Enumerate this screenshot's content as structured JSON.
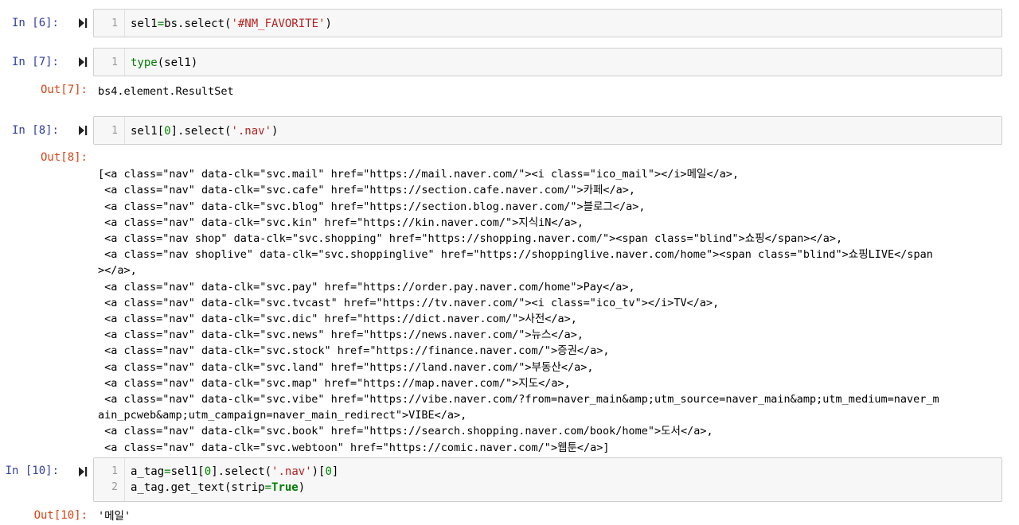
{
  "cells": {
    "c6": {
      "in_prompt": "In [6]:",
      "line": "1"
    },
    "c7": {
      "in_prompt": "In [7]:",
      "line": "1",
      "out_prompt": "Out[7]:",
      "output": "bs4.element.ResultSet"
    },
    "c8": {
      "in_prompt": "In [8]:",
      "line": "1",
      "out_prompt": "Out[8]:",
      "output_lines": [
        "[<a class=\"nav\" data-clk=\"svc.mail\" href=\"https://mail.naver.com/\"><i class=\"ico_mail\"></i>메일</a>,",
        " <a class=\"nav\" data-clk=\"svc.cafe\" href=\"https://section.cafe.naver.com/\">카페</a>,",
        " <a class=\"nav\" data-clk=\"svc.blog\" href=\"https://section.blog.naver.com/\">블로그</a>,",
        " <a class=\"nav\" data-clk=\"svc.kin\" href=\"https://kin.naver.com/\">지식iN</a>,",
        " <a class=\"nav shop\" data-clk=\"svc.shopping\" href=\"https://shopping.naver.com/\"><span class=\"blind\">쇼핑</span></a>,",
        " <a class=\"nav shoplive\" data-clk=\"svc.shoppinglive\" href=\"https://shoppinglive.naver.com/home\"><span class=\"blind\">쇼핑LIVE</span",
        "></a>,",
        " <a class=\"nav\" data-clk=\"svc.pay\" href=\"https://order.pay.naver.com/home\">Pay</a>,",
        " <a class=\"nav\" data-clk=\"svc.tvcast\" href=\"https://tv.naver.com/\"><i class=\"ico_tv\"></i>TV</a>,",
        " <a class=\"nav\" data-clk=\"svc.dic\" href=\"https://dict.naver.com/\">사전</a>,",
        " <a class=\"nav\" data-clk=\"svc.news\" href=\"https://news.naver.com/\">뉴스</a>,",
        " <a class=\"nav\" data-clk=\"svc.stock\" href=\"https://finance.naver.com/\">증권</a>,",
        " <a class=\"nav\" data-clk=\"svc.land\" href=\"https://land.naver.com/\">부동산</a>,",
        " <a class=\"nav\" data-clk=\"svc.map\" href=\"https://map.naver.com/\">지도</a>,",
        " <a class=\"nav\" data-clk=\"svc.vibe\" href=\"https://vibe.naver.com/?from=naver_main&amp;utm_source=naver_main&amp;utm_medium=naver_m",
        "ain_pcweb&amp;utm_campaign=naver_main_redirect\">VIBE</a>,",
        " <a class=\"nav\" data-clk=\"svc.book\" href=\"https://search.shopping.naver.com/book/home\">도서</a>,",
        " <a class=\"nav\" data-clk=\"svc.webtoon\" href=\"https://comic.naver.com/\">웹툰</a>]"
      ]
    },
    "c10": {
      "in_prompt": "In [10]:",
      "line1": "1",
      "line2": "2",
      "out_prompt": "Out[10]:",
      "output": "'메일'"
    }
  },
  "code": {
    "c6": {
      "var": "sel1",
      "eq": "=",
      "pre": "bs.select(",
      "str": "'#NM_FAVORITE'",
      "post": ")"
    },
    "c7": {
      "fn": "type",
      "args": "(sel1)"
    },
    "c8": {
      "pre": "sel1[",
      "num": "0",
      "mid": "].select(",
      "str": "'.nav'",
      "post": ")"
    },
    "c10_l1": {
      "var": "a_tag",
      "eq": "=",
      "pre": "sel1[",
      "num": "0",
      "mid": "].select(",
      "str": "'.nav'",
      "mid2": ")[",
      "num2": "0",
      "post": "]"
    },
    "c10_l2": {
      "pre": "a_tag.get_text(strip",
      "eq": "=",
      "kw": "True",
      "post": ")"
    }
  },
  "icons": {
    "run": "run-cell-icon"
  },
  "colors": {
    "in_prompt": "#303F9F",
    "out_prompt": "#D84315",
    "string": "#BA2121",
    "builtin": "#008000"
  }
}
